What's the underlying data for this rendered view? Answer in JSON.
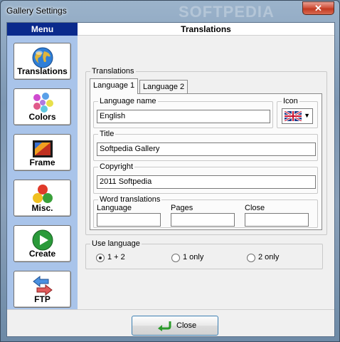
{
  "window": {
    "title": "Gallery Settings",
    "watermark": "SOFTPEDIA",
    "close_glyph": "✕"
  },
  "menu": {
    "header": "Menu",
    "items": [
      {
        "label": "Translations",
        "icon": "globe-icon"
      },
      {
        "label": "Colors",
        "icon": "palette-icon"
      },
      {
        "label": "Frame",
        "icon": "frame-icon"
      },
      {
        "label": "Misc.",
        "icon": "circles-icon"
      },
      {
        "label": "Create",
        "icon": "play-icon"
      },
      {
        "label": "FTP",
        "icon": "transfer-arrows-icon"
      }
    ]
  },
  "panel": {
    "header": "Translations",
    "group_label": "Translations",
    "tabs": [
      "Language 1",
      "Language 2"
    ],
    "active_tab": 0,
    "language_name": {
      "label": "Language name",
      "value": "English"
    },
    "icon": {
      "label": "Icon",
      "value": "uk-flag-icon"
    },
    "title": {
      "label": "Title",
      "value": "Softpedia Gallery"
    },
    "copyright": {
      "label": "Copyright",
      "value": "2011 Softpedia"
    },
    "word_translations": {
      "label": "Word translations",
      "fields": [
        {
          "label": "Language",
          "value": ""
        },
        {
          "label": "Pages",
          "value": ""
        },
        {
          "label": "Close",
          "value": ""
        }
      ]
    },
    "use_language": {
      "label": "Use language",
      "options": [
        "1 + 2",
        "1 only",
        "2 only"
      ],
      "selected": "1 + 2"
    }
  },
  "footer": {
    "close_label": "Close"
  }
}
